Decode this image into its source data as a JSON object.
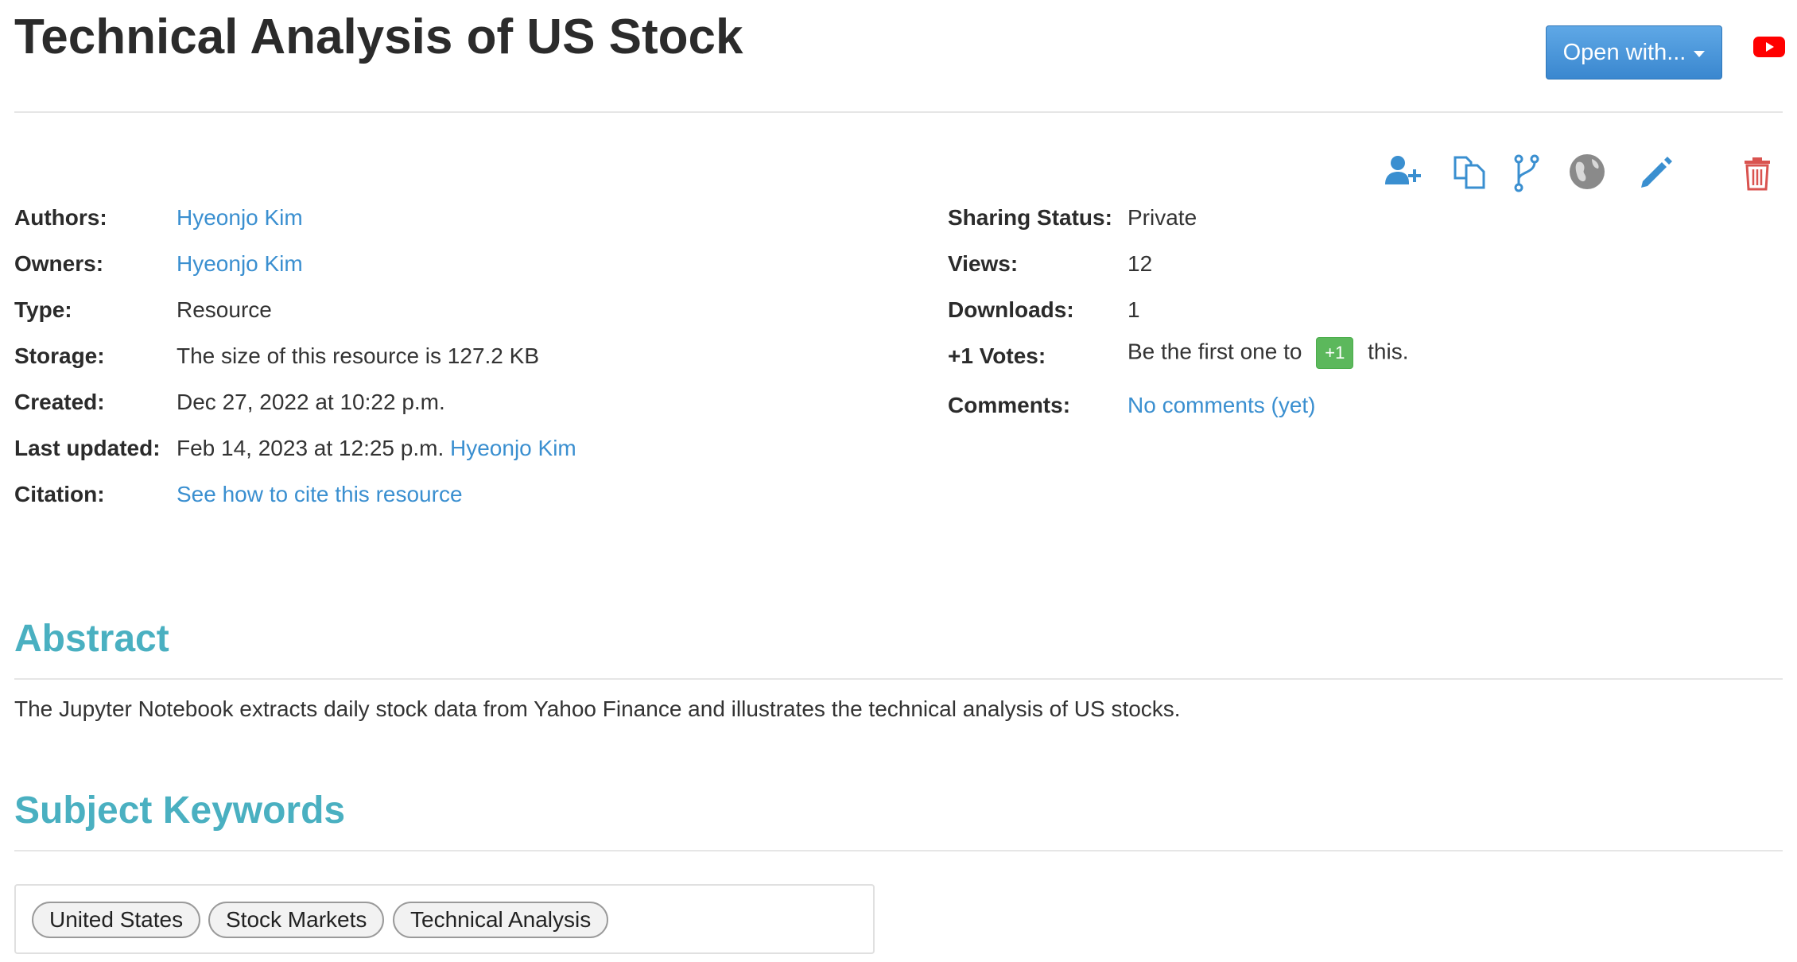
{
  "page": {
    "title": "Technical Analysis of US Stock"
  },
  "header": {
    "open_with_label": "Open with...",
    "youtube_icon": "youtube-icon"
  },
  "toolbar": {
    "icons": [
      "add-user-icon",
      "copy-icon",
      "fork-icon",
      "globe-icon",
      "pencil-icon",
      "trash-icon"
    ]
  },
  "metadata_left": {
    "authors_label": "Authors:",
    "authors_value": "Hyeonjo Kim",
    "owners_label": "Owners:",
    "owners_value": "Hyeonjo Kim",
    "type_label": "Type:",
    "type_value": "Resource",
    "storage_label": "Storage:",
    "storage_value": "The size of this resource is 127.2 KB",
    "created_label": "Created:",
    "created_value": "Dec 27, 2022 at 10:22 p.m.",
    "updated_label": "Last updated:",
    "updated_value": "Feb 14, 2023 at 12:25 p.m.",
    "updated_by": "Hyeonjo Kim",
    "citation_label": "Citation:",
    "citation_value": "See how to cite this resource"
  },
  "metadata_right": {
    "sharing_label": "Sharing Status:",
    "sharing_value": "Private",
    "views_label": "Views:",
    "views_value": "12",
    "downloads_label": "Downloads:",
    "downloads_value": "1",
    "votes_label": "+1 Votes:",
    "votes_prefix": "Be the first one to",
    "votes_button": "+1",
    "votes_suffix": "this.",
    "comments_label": "Comments:",
    "comments_value": "No comments (yet)"
  },
  "abstract": {
    "heading": "Abstract",
    "text": "The Jupyter Notebook extracts daily stock data from Yahoo Finance and illustrates the technical analysis of US stocks."
  },
  "keywords": {
    "heading": "Subject Keywords",
    "items": [
      "United States",
      "Stock Markets",
      "Technical Analysis"
    ]
  },
  "colors": {
    "accent_blue": "#3a8fd0",
    "section_teal": "#4ab0c1",
    "vote_green": "#5cb85c",
    "delete_red": "#d9534f"
  }
}
